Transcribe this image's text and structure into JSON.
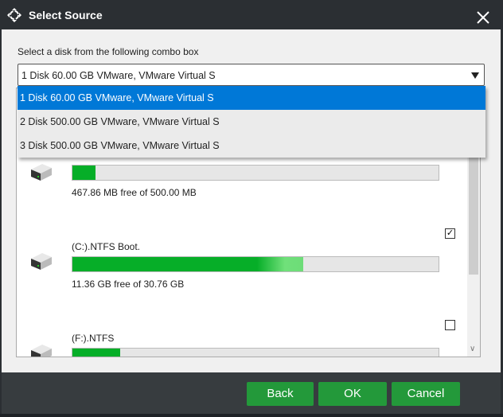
{
  "title": "Select Source",
  "instruction": "Select a disk from the following combo box",
  "combo": {
    "selected": "1 Disk 60.00 GB VMware,  VMware Virtual S",
    "options": [
      "1 Disk 60.00 GB VMware,  VMware Virtual S",
      "2 Disk 500.00 GB VMware,  VMware Virtual S",
      "3 Disk 500.00 GB VMware,  VMware Virtual S"
    ]
  },
  "partitions": [
    {
      "name": "",
      "free": "467.86 MB free of 500.00 MB",
      "used_fraction": 0.064,
      "checked": null
    },
    {
      "name": "(C:).NTFS Boot.",
      "free": "11.36 GB free of 30.76 GB",
      "used_fraction": 0.63,
      "checked": true
    },
    {
      "name": "(F:).NTFS",
      "free": "",
      "used_fraction": 0.13,
      "checked": false
    }
  ],
  "buttons": {
    "back": "Back",
    "ok": "OK",
    "cancel": "Cancel"
  },
  "colors": {
    "accent": "#23993a",
    "selection": "#0078d7",
    "bar_fill": "#06ae28"
  }
}
